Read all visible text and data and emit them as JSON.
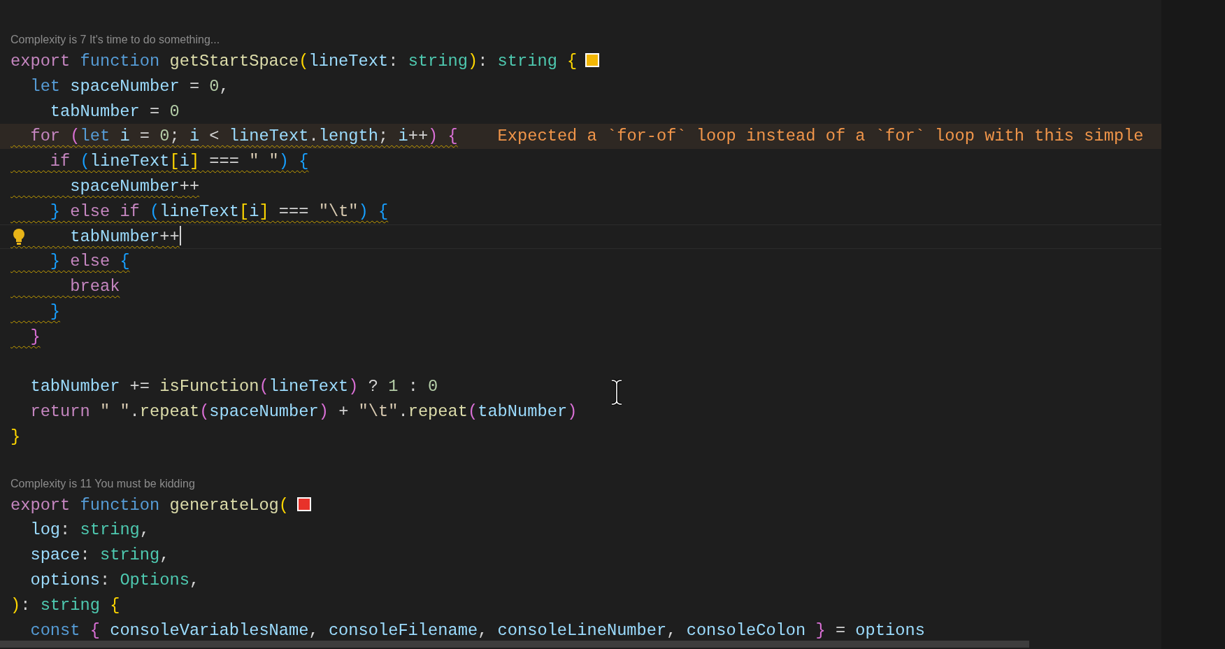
{
  "blocks": [
    {
      "annotation": "Complexity is 7 It's time to do something...",
      "lines": [
        {
          "kind": "plain",
          "tokens": [
            {
              "kind": "kw",
              "text": "export "
            },
            {
              "kind": "decl",
              "text": "function "
            },
            {
              "kind": "fn",
              "text": "getStartSpace"
            },
            {
              "kind": "b1",
              "text": "("
            },
            {
              "kind": "var",
              "text": "lineText"
            },
            {
              "kind": "op",
              "text": ": "
            },
            {
              "kind": "type",
              "text": "string"
            },
            {
              "kind": "b1",
              "text": ")"
            },
            {
              "kind": "op",
              "text": ": "
            },
            {
              "kind": "type",
              "text": "string "
            },
            {
              "kind": "b1",
              "text": "{"
            }
          ],
          "marker": {
            "color": "#f2b705"
          }
        },
        {
          "kind": "plain",
          "tokens": [
            {
              "kind": "decl",
              "text": "  let "
            },
            {
              "kind": "var",
              "text": "spaceNumber"
            },
            {
              "kind": "op",
              "text": " = "
            },
            {
              "kind": "num",
              "text": "0"
            },
            {
              "kind": "op",
              "text": ","
            }
          ]
        },
        {
          "kind": "plain",
          "tokens": [
            {
              "kind": "var",
              "text": "    tabNumber"
            },
            {
              "kind": "op",
              "text": " = "
            },
            {
              "kind": "num",
              "text": "0"
            }
          ]
        },
        {
          "kind": "warn-focus",
          "tokens": [
            {
              "kind": "kw",
              "text": "  for "
            },
            {
              "kind": "b2",
              "text": "("
            },
            {
              "kind": "decl",
              "text": "let "
            },
            {
              "kind": "var",
              "text": "i"
            },
            {
              "kind": "op",
              "text": " = "
            },
            {
              "kind": "num",
              "text": "0"
            },
            {
              "kind": "op",
              "text": "; "
            },
            {
              "kind": "var",
              "text": "i"
            },
            {
              "kind": "op",
              "text": " < "
            },
            {
              "kind": "var",
              "text": "lineText"
            },
            {
              "kind": "op",
              "text": "."
            },
            {
              "kind": "var",
              "text": "length"
            },
            {
              "kind": "op",
              "text": "; "
            },
            {
              "kind": "var",
              "text": "i"
            },
            {
              "kind": "op",
              "text": "++"
            },
            {
              "kind": "b2",
              "text": ")"
            },
            {
              "kind": "b2",
              "text": " {"
            }
          ],
          "message": "Expected a `for-of` loop instead of a `for` loop with this simple"
        },
        {
          "kind": "warn",
          "tokens": [
            {
              "kind": "kw",
              "text": "    if "
            },
            {
              "kind": "b3",
              "text": "("
            },
            {
              "kind": "var",
              "text": "lineText"
            },
            {
              "kind": "b1",
              "text": "["
            },
            {
              "kind": "var",
              "text": "i"
            },
            {
              "kind": "b1",
              "text": "]"
            },
            {
              "kind": "op",
              "text": " === "
            },
            {
              "kind": "str",
              "text": "\" \""
            },
            {
              "kind": "b3",
              "text": ")"
            },
            {
              "kind": "b3",
              "text": " {"
            }
          ]
        },
        {
          "kind": "warn",
          "tokens": [
            {
              "kind": "var",
              "text": "      spaceNumber"
            },
            {
              "kind": "op",
              "text": "++"
            }
          ]
        },
        {
          "kind": "warn",
          "tokens": [
            {
              "kind": "b3",
              "text": "    } "
            },
            {
              "kind": "kw",
              "text": "else "
            },
            {
              "kind": "kw",
              "text": "if "
            },
            {
              "kind": "b3",
              "text": "("
            },
            {
              "kind": "var",
              "text": "lineText"
            },
            {
              "kind": "b1",
              "text": "["
            },
            {
              "kind": "var",
              "text": "i"
            },
            {
              "kind": "b1",
              "text": "]"
            },
            {
              "kind": "op",
              "text": " === "
            },
            {
              "kind": "str",
              "text": "\"\\t\""
            },
            {
              "kind": "b3",
              "text": ")"
            },
            {
              "kind": "b3",
              "text": " {"
            }
          ]
        },
        {
          "kind": "warn-current",
          "tokens": [
            {
              "kind": "var",
              "text": "      tabNumber"
            },
            {
              "kind": "op",
              "text": "++"
            }
          ]
        },
        {
          "kind": "warn",
          "tokens": [
            {
              "kind": "b3",
              "text": "    } "
            },
            {
              "kind": "kw",
              "text": "else "
            },
            {
              "kind": "b3",
              "text": "{"
            }
          ]
        },
        {
          "kind": "warn",
          "tokens": [
            {
              "kind": "kw",
              "text": "      break"
            }
          ]
        },
        {
          "kind": "warn",
          "tokens": [
            {
              "kind": "b3",
              "text": "    }"
            }
          ]
        },
        {
          "kind": "warn",
          "tokens": [
            {
              "kind": "b2",
              "text": "  }"
            }
          ]
        },
        {
          "kind": "blank"
        },
        {
          "kind": "plain",
          "tokens": [
            {
              "kind": "var",
              "text": "  tabNumber"
            },
            {
              "kind": "op",
              "text": " += "
            },
            {
              "kind": "fn",
              "text": "isFunction"
            },
            {
              "kind": "b2",
              "text": "("
            },
            {
              "kind": "var",
              "text": "lineText"
            },
            {
              "kind": "b2",
              "text": ")"
            },
            {
              "kind": "op",
              "text": " ? "
            },
            {
              "kind": "num",
              "text": "1"
            },
            {
              "kind": "op",
              "text": " : "
            },
            {
              "kind": "num",
              "text": "0"
            }
          ]
        },
        {
          "kind": "plain",
          "tokens": [
            {
              "kind": "kw",
              "text": "  return "
            },
            {
              "kind": "str",
              "text": "\" \""
            },
            {
              "kind": "op",
              "text": "."
            },
            {
              "kind": "fn",
              "text": "repeat"
            },
            {
              "kind": "b2",
              "text": "("
            },
            {
              "kind": "var",
              "text": "spaceNumber"
            },
            {
              "kind": "b2",
              "text": ")"
            },
            {
              "kind": "op",
              "text": " + "
            },
            {
              "kind": "str",
              "text": "\"\\t\""
            },
            {
              "kind": "op",
              "text": "."
            },
            {
              "kind": "fn",
              "text": "repeat"
            },
            {
              "kind": "b2",
              "text": "("
            },
            {
              "kind": "var",
              "text": "tabNumber"
            },
            {
              "kind": "b2",
              "text": ")"
            }
          ]
        },
        {
          "kind": "plain",
          "tokens": [
            {
              "kind": "b1",
              "text": "}"
            }
          ]
        },
        {
          "kind": "blank"
        }
      ]
    },
    {
      "annotation": "Complexity is 11 You must be kidding",
      "lines": [
        {
          "kind": "plain",
          "tokens": [
            {
              "kind": "kw",
              "text": "export "
            },
            {
              "kind": "decl",
              "text": "function "
            },
            {
              "kind": "fn",
              "text": "generateLog"
            },
            {
              "kind": "b1",
              "text": "("
            }
          ],
          "marker": {
            "color": "#e8322a"
          }
        },
        {
          "kind": "plain",
          "tokens": [
            {
              "kind": "var",
              "text": "  log"
            },
            {
              "kind": "op",
              "text": ": "
            },
            {
              "kind": "type",
              "text": "string"
            },
            {
              "kind": "op",
              "text": ","
            }
          ]
        },
        {
          "kind": "plain",
          "tokens": [
            {
              "kind": "var",
              "text": "  space"
            },
            {
              "kind": "op",
              "text": ": "
            },
            {
              "kind": "type",
              "text": "string"
            },
            {
              "kind": "op",
              "text": ","
            }
          ]
        },
        {
          "kind": "plain",
          "tokens": [
            {
              "kind": "var",
              "text": "  options"
            },
            {
              "kind": "op",
              "text": ": "
            },
            {
              "kind": "type",
              "text": "Options"
            },
            {
              "kind": "op",
              "text": ","
            }
          ]
        },
        {
          "kind": "plain",
          "tokens": [
            {
              "kind": "b1",
              "text": ")"
            },
            {
              "kind": "op",
              "text": ": "
            },
            {
              "kind": "type",
              "text": "string "
            },
            {
              "kind": "b1",
              "text": "{"
            }
          ]
        },
        {
          "kind": "plain",
          "tokens": [
            {
              "kind": "decl",
              "text": "  const "
            },
            {
              "kind": "b2",
              "text": "{"
            },
            {
              "kind": "var",
              "text": " consoleVariablesName"
            },
            {
              "kind": "op",
              "text": ", "
            },
            {
              "kind": "var",
              "text": "consoleFilename"
            },
            {
              "kind": "op",
              "text": ", "
            },
            {
              "kind": "var",
              "text": "consoleLineNumber"
            },
            {
              "kind": "op",
              "text": ", "
            },
            {
              "kind": "var",
              "text": "consoleColon "
            },
            {
              "kind": "b2",
              "text": "}"
            },
            {
              "kind": "op",
              "text": " = "
            },
            {
              "kind": "var",
              "text": "options"
            }
          ]
        }
      ]
    }
  ]
}
